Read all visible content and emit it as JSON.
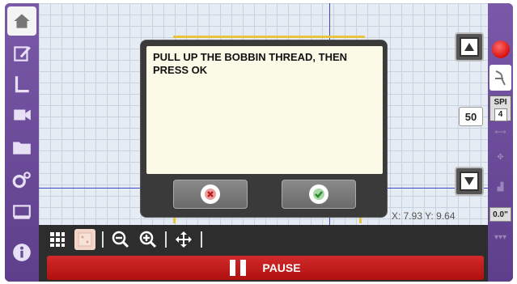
{
  "left_sidebar": {
    "items": [
      {
        "icon": "home-icon",
        "label": "Home"
      },
      {
        "icon": "edit-icon",
        "label": "Edit"
      },
      {
        "icon": "stitch-icon",
        "label": "Stitch"
      },
      {
        "icon": "video-icon",
        "label": "Video"
      },
      {
        "icon": "folder-icon",
        "label": "Files"
      },
      {
        "icon": "settings-icon",
        "label": "Settings"
      },
      {
        "icon": "machine-icon",
        "label": "Machine"
      },
      {
        "icon": "info-icon",
        "label": "Info"
      }
    ]
  },
  "canvas": {
    "value_box": "50",
    "coords": "X: 7.93 Y: 9.64"
  },
  "dialog": {
    "message": "PULL UP THE BOBBIN THREAD, THEN PRESS OK",
    "cancel_icon": "x-circle-icon",
    "ok_icon": "check-circle-icon"
  },
  "right_sidebar": {
    "spi_label": "SPI",
    "spi_value": "4",
    "offset_value": "0.0\""
  },
  "toolbar": {
    "pause_label": "PAUSE"
  },
  "colors": {
    "sidebar": "#6a4c99",
    "pause": "#c41c1c",
    "dialog_bg": "#fbfae6",
    "axis": "#3b49c4",
    "hoop": "#e8c43c"
  }
}
